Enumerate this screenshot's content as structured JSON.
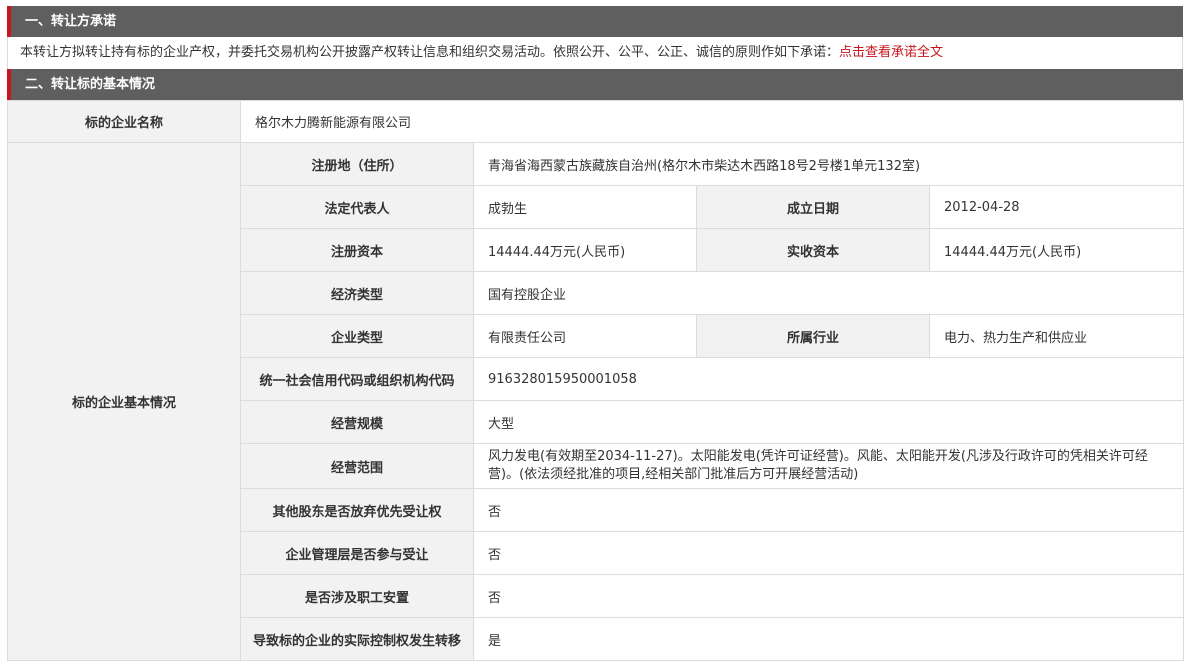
{
  "section1": {
    "title": "一、转让方承诺"
  },
  "promise": {
    "text": "本转让方拟转让持有标的企业产权，并委托交易机构公开披露产权转让信息和组织交易活动。依照公开、公平、公正、诚信的原则作如下承诺：",
    "link": "点击查看承诺全文"
  },
  "section2": {
    "title": "二、转让标的基本情况"
  },
  "company_name": {
    "label": "标的企业名称",
    "value": "格尔木力腾新能源有限公司"
  },
  "basic": {
    "label": "标的企业基本情况",
    "rows": {
      "address": {
        "label": "注册地（住所）",
        "value": "青海省海西蒙古族藏族自治州(格尔木市柴达木西路18号2号楼1单元132室)"
      },
      "legal_rep": {
        "label": "法定代表人",
        "value": "成勃生"
      },
      "established": {
        "label": "成立日期",
        "value": "2012-04-28"
      },
      "reg_capital": {
        "label": "注册资本",
        "value": "14444.44万元(人民币)"
      },
      "paid_capital": {
        "label": "实收资本",
        "value": "14444.44万元(人民币)"
      },
      "econ_type": {
        "label": "经济类型",
        "value": "国有控股企业"
      },
      "company_type": {
        "label": "企业类型",
        "value": "有限责任公司"
      },
      "industry": {
        "label": "所属行业",
        "value": "电力、热力生产和供应业"
      },
      "credit_code": {
        "label": "统一社会信用代码或组织机构代码",
        "value": "916328015950001058"
      },
      "scale": {
        "label": "经营规模",
        "value": "大型"
      },
      "scope": {
        "label": "经营范围",
        "value": "风力发电(有效期至2034-11-27)。太阳能发电(凭许可证经营)。风能、太阳能开发(凡涉及行政许可的凭相关许可经营)。(依法须经批准的项目,经相关部门批准后方可开展经营活动)"
      },
      "waive": {
        "label": "其他股东是否放弃优先受让权",
        "value": "否"
      },
      "mgmt": {
        "label": "企业管理层是否参与受让",
        "value": "否"
      },
      "staff": {
        "label": "是否涉及职工安置",
        "value": "否"
      },
      "control": {
        "label": "导致标的企业的实际控制权发生转移",
        "value": "是"
      }
    }
  }
}
